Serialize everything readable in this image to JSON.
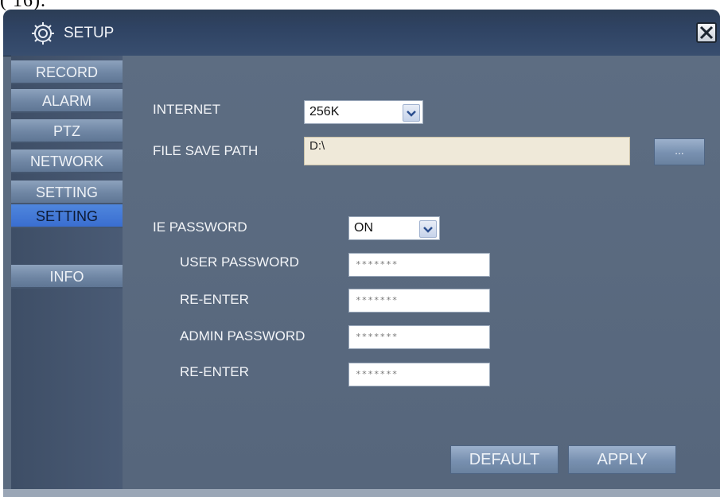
{
  "caption_fragment": "( 16).",
  "window": {
    "title": "SETUP",
    "title_icon": "gear-icon",
    "close_icon": "close-icon"
  },
  "sidebar": {
    "items": [
      {
        "label": "RECORD"
      },
      {
        "label": "ALARM"
      },
      {
        "label": "PTZ"
      },
      {
        "label": "NETWORK"
      },
      {
        "label": "SETTING"
      },
      {
        "label": "SETTING",
        "active": true
      },
      {
        "label": "INFO"
      }
    ]
  },
  "form": {
    "internet_label": "INTERNET",
    "internet_value": "256K",
    "file_save_path_label": "FILE SAVE PATH",
    "file_save_path_value": "D:\\",
    "browse_label": "...",
    "ie_password_label": "IE PASSWORD",
    "ie_password_value": "ON",
    "user_password_label": "USER PASSWORD",
    "user_password_value": "*******",
    "user_reenter_label": "RE-ENTER",
    "user_reenter_value": "*******",
    "admin_password_label": "ADMIN PASSWORD",
    "admin_password_value": "*******",
    "admin_reenter_label": "RE-ENTER",
    "admin_reenter_value": "*******"
  },
  "buttons": {
    "default_label": "DEFAULT",
    "apply_label": "APPLY"
  },
  "colors": {
    "active_nav": "#3a6ed0",
    "content_bg": "#5b6b80",
    "title_bg": "#2f4363"
  }
}
